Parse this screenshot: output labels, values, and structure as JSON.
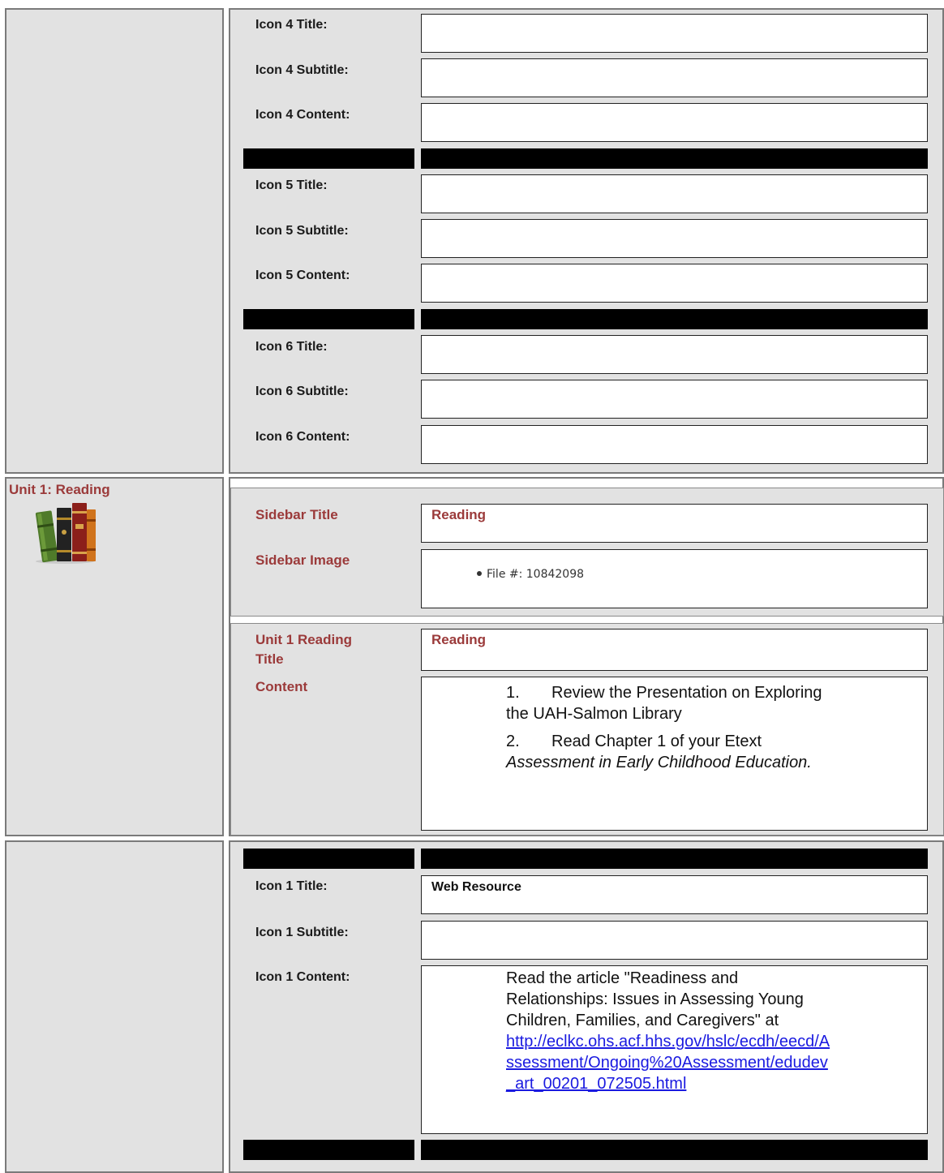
{
  "section_icons_4_6": {
    "icon4": {
      "title_label": "Icon 4 Title:",
      "subtitle_label": "Icon 4 Subtitle:",
      "content_label": "Icon 4 Content:"
    },
    "icon5": {
      "title_label": "Icon 5 Title:",
      "subtitle_label": "Icon 5 Subtitle:",
      "content_label": "Icon 5 Content:"
    },
    "icon6": {
      "title_label": "Icon 6 Title:",
      "subtitle_label": "Icon 6 Subtitle:",
      "content_label": "Icon 6 Content:"
    }
  },
  "unit1": {
    "heading": "Unit 1: Reading",
    "icon": "books-icon",
    "sidebar": {
      "title_label": "Sidebar Title",
      "title_value": "Reading",
      "image_label": "Sidebar Image",
      "image_file": "File #: 10842098"
    },
    "reading": {
      "title_label_line1": "Unit 1 Reading",
      "title_label_line2": "Title",
      "title_value": "Reading",
      "content_label": "Content",
      "item1_num": "1.",
      "item1_text_a": "Review the Presentation on Exploring",
      "item1_text_b": "the UAH-Salmon Library",
      "item2_num": "2.",
      "item2_text": "Read Chapter 1 of your Etext",
      "item2_italic": "Assessment in Early Childhood Education."
    }
  },
  "section_icon1": {
    "title_label": "Icon 1 Title:",
    "title_value": "Web Resource",
    "subtitle_label": "Icon 1 Subtitle:",
    "content_label": "Icon 1 Content:",
    "content_line1": "Read the article \"Readiness and",
    "content_line2": "Relationships: Issues in Assessing Young",
    "content_line3": "Children, Families, and Caregivers\" at",
    "link_line1": "http://eclkc.ohs.acf.hhs.gov/hslc/ecdh/eecd/A",
    "link_line2": "ssessment/Ongoing%20Assessment/edudev",
    "link_line3": "_art_00201_072505.html"
  },
  "colors": {
    "label_accent": "#9b3a3a",
    "panel_gray": "#e2e2e2",
    "link": "#1a1ae0"
  }
}
